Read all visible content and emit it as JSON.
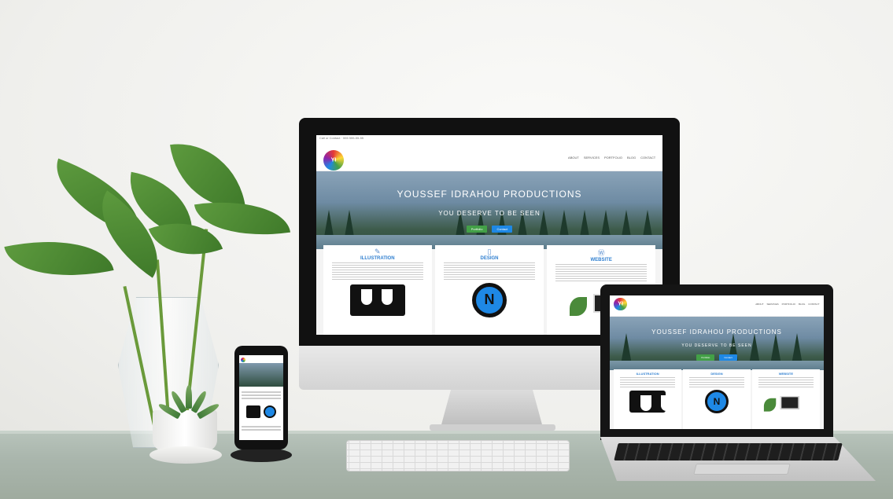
{
  "site": {
    "top_bar": "Call or Contact · 555 555-55-55",
    "logo_text": "YI",
    "nav": [
      "ABOUT",
      "SERVICES",
      "PORTFOLIO",
      "BLOG",
      "CONTACT"
    ],
    "hero_title": "YOUSSEF IDRAHOU PRODUCTIONS",
    "hero_tagline": "YOU DESERVE TO BE SEEN",
    "buttons": [
      "Portfolio",
      "Contact"
    ],
    "cards": [
      {
        "icon": "pen-nib-icon",
        "title": "ILLUSTRATION"
      },
      {
        "icon": "tablet-icon",
        "title": "DESIGN"
      },
      {
        "icon": "wordpress-icon",
        "title": "WEBSITE"
      }
    ]
  }
}
